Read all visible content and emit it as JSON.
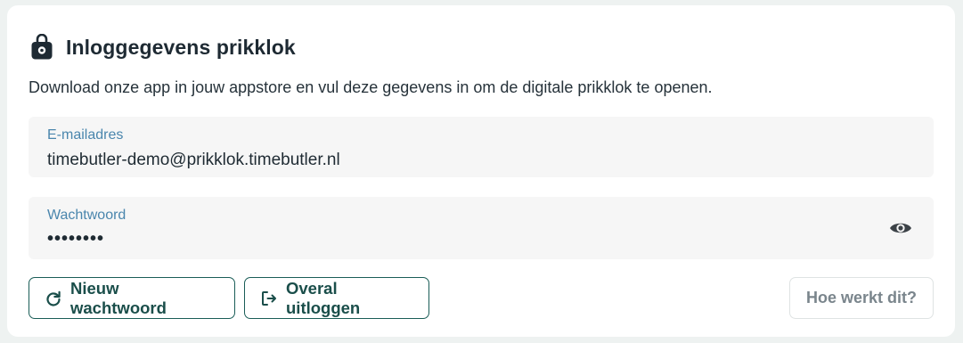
{
  "header": {
    "icon": "lock-bag-icon",
    "title": "Inloggegevens prikklok"
  },
  "description": "Download onze app in jouw appstore en vul deze gegevens in om de digitale prikklok te openen.",
  "email_field": {
    "label": "E-mailadres",
    "value": "timebutler-demo@prikklok.timebutler.nl"
  },
  "password_field": {
    "label": "Wachtwoord",
    "value": "••••••••",
    "toggle_icon": "eye-icon"
  },
  "actions": {
    "reset_label": "Nieuw wachtwoord",
    "reset_icon": "refresh-icon",
    "logout_label": "Overal uitloggen",
    "logout_icon": "logout-icon",
    "help_label": "Hoe werkt dit?"
  },
  "colors": {
    "accent": "#1a5d57",
    "label": "#4a86ad",
    "field_bg": "#f6f6f6"
  }
}
